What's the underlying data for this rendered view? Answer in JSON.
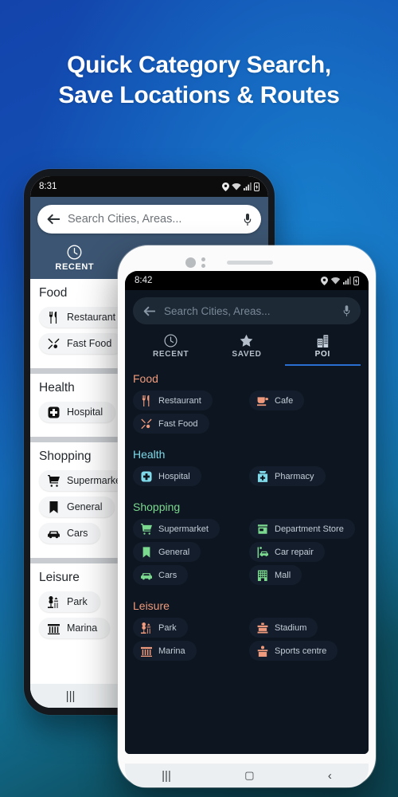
{
  "headline": {
    "line1": "Quick Category Search,",
    "line2": "Save Locations & Routes"
  },
  "colors": {
    "bg_blue": "#1344ac",
    "bg_teal": "#0c4350",
    "accent_blue": "#2a6fd0",
    "food": "#ef9a7c",
    "health": "#7fd9e8",
    "shopping": "#7bd88f",
    "leisure": "#ef9a7c"
  },
  "back_phone": {
    "status": {
      "time": "8:31"
    },
    "search": {
      "placeholder": "Search Cities, Areas...",
      "back_icon": "arrow-left-icon",
      "mic_icon": "microphone-icon"
    },
    "tabs": [
      {
        "label": "RECENT",
        "icon": "clock-icon",
        "active": true
      }
    ],
    "sections": [
      {
        "title": "Food",
        "items": [
          {
            "label": "Restaurant",
            "icon": "cutlery-icon"
          },
          {
            "label": "Fast Food",
            "icon": "fast-food-icon"
          }
        ]
      },
      {
        "title": "Health",
        "items": [
          {
            "label": "Hospital",
            "icon": "hospital-icon"
          }
        ]
      },
      {
        "title": "Shopping",
        "items": [
          {
            "label": "Supermarket",
            "icon": "shopping-cart-icon"
          },
          {
            "label": "General",
            "icon": "bookmark-icon"
          },
          {
            "label": "Cars",
            "icon": "car-icon"
          }
        ]
      },
      {
        "title": "Leisure",
        "items": [
          {
            "label": "Park",
            "icon": "park-icon"
          },
          {
            "label": "Marina",
            "icon": "marina-icon"
          }
        ]
      }
    ],
    "nav": {
      "recents": "|||",
      "home": "▢",
      "back": "‹"
    }
  },
  "front_phone": {
    "status": {
      "time": "8:42",
      "icons": [
        "location-pin-icon",
        "wifi-icon",
        "signal-icon",
        "battery-icon"
      ]
    },
    "search": {
      "placeholder": "Search Cities, Areas...",
      "back_icon": "arrow-left-icon",
      "mic_icon": "microphone-icon"
    },
    "tabs": [
      {
        "label": "RECENT",
        "icon": "clock-icon",
        "active": false
      },
      {
        "label": "SAVED",
        "icon": "star-icon",
        "active": false
      },
      {
        "label": "POI",
        "icon": "buildings-icon",
        "active": true
      }
    ],
    "sections": [
      {
        "title": "Food",
        "color": "#ef9a7c",
        "items": [
          {
            "label": "Restaurant",
            "icon": "cutlery-icon"
          },
          {
            "label": "Cafe",
            "icon": "coffee-cup-icon"
          },
          {
            "label": "Fast Food",
            "icon": "fast-food-icon"
          }
        ]
      },
      {
        "title": "Health",
        "color": "#7fd9e8",
        "items": [
          {
            "label": "Hospital",
            "icon": "hospital-icon"
          },
          {
            "label": "Pharmacy",
            "icon": "pharmacy-icon"
          }
        ]
      },
      {
        "title": "Shopping",
        "color": "#7bd88f",
        "items": [
          {
            "label": "Supermarket",
            "icon": "shopping-cart-icon"
          },
          {
            "label": "Department Store",
            "icon": "store-icon"
          },
          {
            "label": "General",
            "icon": "bookmark-icon"
          },
          {
            "label": "Car repair",
            "icon": "car-repair-icon"
          },
          {
            "label": "Cars",
            "icon": "car-icon"
          },
          {
            "label": "Mall",
            "icon": "mall-icon"
          }
        ]
      },
      {
        "title": "Leisure",
        "color": "#ef9a7c",
        "items": [
          {
            "label": "Park",
            "icon": "park-icon"
          },
          {
            "label": "Stadium",
            "icon": "stadium-icon"
          },
          {
            "label": "Marina",
            "icon": "marina-icon"
          },
          {
            "label": "Sports centre",
            "icon": "sports-centre-icon"
          }
        ]
      }
    ],
    "nav": {
      "recents": "|||",
      "home": "▢",
      "back": "‹"
    }
  }
}
